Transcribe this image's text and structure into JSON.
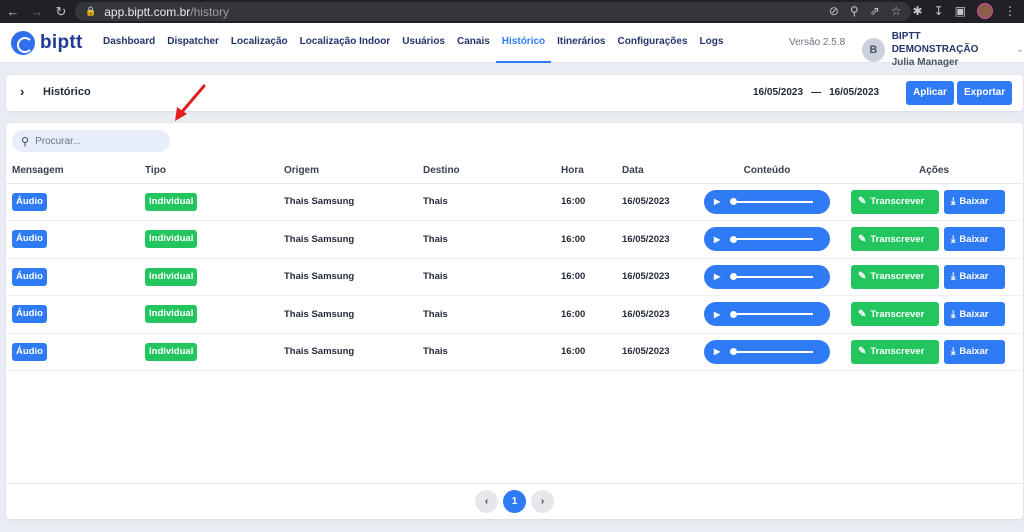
{
  "browser": {
    "url_host": "app.biptt.com.br",
    "url_path": "/history"
  },
  "app": {
    "logo_text": "biptt",
    "menu": [
      {
        "label": "Dashboard"
      },
      {
        "label": "Dispatcher"
      },
      {
        "label": "Localização"
      },
      {
        "label": "Localização Indoor"
      },
      {
        "label": "Usuários"
      },
      {
        "label": "Canais"
      },
      {
        "label": "Histórico",
        "active": true
      },
      {
        "label": "Itinerários"
      },
      {
        "label": "Configurações"
      },
      {
        "label": "Logs"
      }
    ],
    "version": "Versão 2.5.8",
    "user": {
      "initial": "B",
      "org": "BIPTT DEMONSTRAÇÃO",
      "name": "Julia Manager"
    }
  },
  "header": {
    "title": "Histórico",
    "date_from": "16/05/2023",
    "date_sep": "—",
    "date_to": "16/05/2023",
    "apply_label": "Aplicar",
    "export_label": "Exportar"
  },
  "search": {
    "placeholder": "Procurar..."
  },
  "table": {
    "columns": {
      "mensagem": "Mensagem",
      "tipo": "Tipo",
      "origem": "Origem",
      "destino": "Destino",
      "hora": "Hora",
      "data": "Data",
      "conteudo": "Conteúdo",
      "acoes": "Ações"
    },
    "rows": [
      {
        "mensagem": "Áudio",
        "tipo": "Individual",
        "origem": "Thais Samsung",
        "destino": "Thais",
        "hora": "16:00",
        "data": "16/05/2023"
      },
      {
        "mensagem": "Áudio",
        "tipo": "Individual",
        "origem": "Thais Samsung",
        "destino": "Thais",
        "hora": "16:00",
        "data": "16/05/2023"
      },
      {
        "mensagem": "Áudio",
        "tipo": "Individual",
        "origem": "Thais Samsung",
        "destino": "Thais",
        "hora": "16:00",
        "data": "16/05/2023"
      },
      {
        "mensagem": "Áudio",
        "tipo": "Individual",
        "origem": "Thais Samsung",
        "destino": "Thais",
        "hora": "16:00",
        "data": "16/05/2023"
      },
      {
        "mensagem": "Áudio",
        "tipo": "Individual",
        "origem": "Thais Samsung",
        "destino": "Thais",
        "hora": "16:00",
        "data": "16/05/2023"
      }
    ],
    "transcribe_label": "Transcrever",
    "download_label": "Baixar"
  },
  "pagination": {
    "current": "1",
    "prev_icon": "chevron-left-icon",
    "next_icon": "chevron-right-icon"
  },
  "colors": {
    "primary": "#2f7bf5",
    "success": "#22c55e",
    "annotation_arrow": "#e02020"
  }
}
